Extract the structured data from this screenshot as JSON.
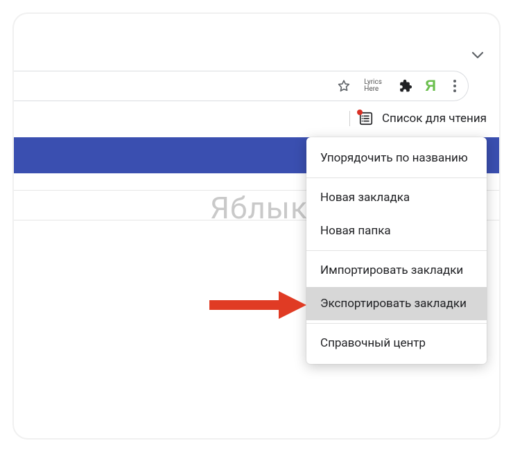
{
  "toolbar": {
    "lyrics_ext_line1": "Lyrics",
    "lyrics_ext_line2": "Here",
    "ya_letter": "Я"
  },
  "reading_list": {
    "label": "Список для чтения"
  },
  "watermark": "Яблык",
  "menu": {
    "sort_by_name": "Упорядочить по названию",
    "new_bookmark": "Новая закладка",
    "new_folder": "Новая папка",
    "import_bookmarks": "Импортировать закладки",
    "export_bookmarks": "Экспортировать закладки",
    "help_center": "Справочный центр"
  }
}
